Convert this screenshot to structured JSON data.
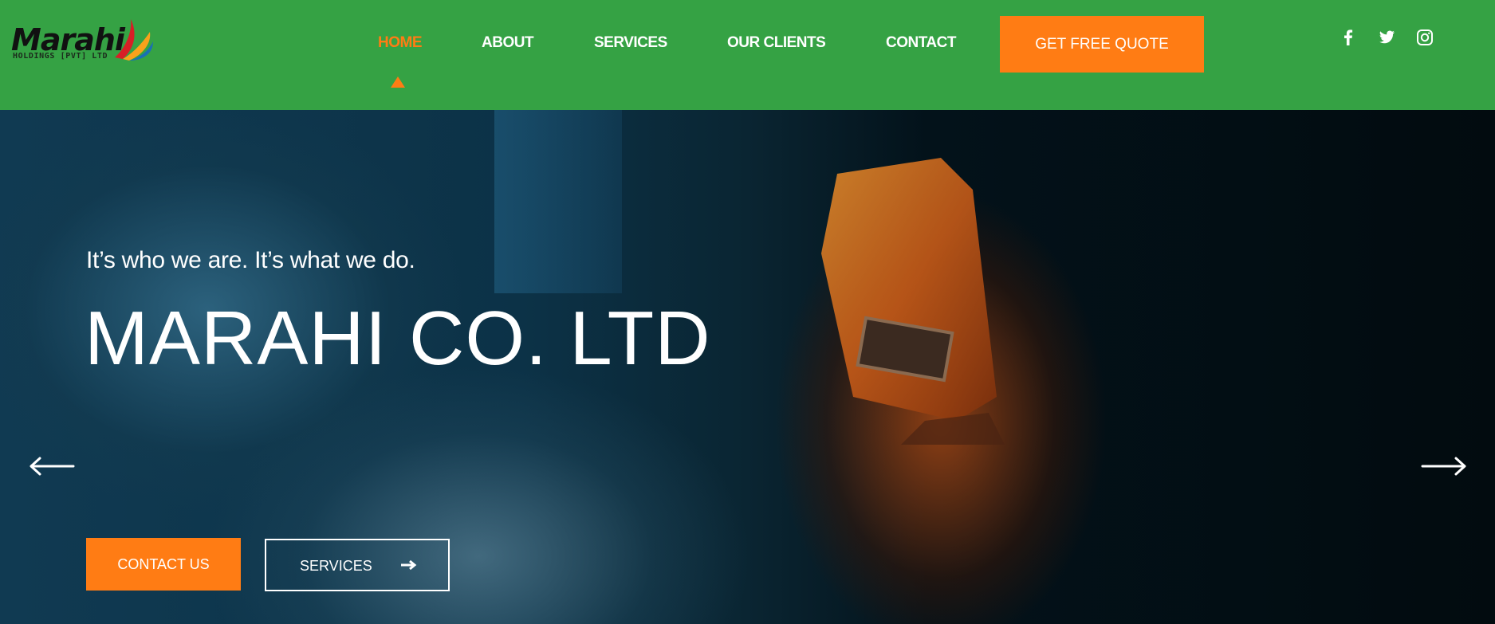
{
  "brand": {
    "name": "Marahi",
    "subtitle": "HOLDINGS [PVT] LTD"
  },
  "nav": {
    "items": [
      {
        "label": "HOME",
        "active": true
      },
      {
        "label": "ABOUT",
        "active": false
      },
      {
        "label": "SERVICES",
        "active": false
      },
      {
        "label": "OUR CLIENTS",
        "active": false
      },
      {
        "label": "CONTACT",
        "active": false
      }
    ],
    "cta_label": "GET FREE QUOTE"
  },
  "social": [
    {
      "icon": "facebook-icon"
    },
    {
      "icon": "twitter-icon"
    },
    {
      "icon": "instagram-icon"
    }
  ],
  "hero": {
    "tagline": "It’s who we are. It’s what we do.",
    "title": "MARAHI CO. LTD",
    "primary_button": "CONTACT US",
    "secondary_button": "SERVICES",
    "prev_icon": "arrow-left-icon",
    "next_icon": "arrow-right-icon"
  },
  "colors": {
    "header_bg": "#35a244",
    "accent": "#ff7c14",
    "text_light": "#ffffff"
  }
}
